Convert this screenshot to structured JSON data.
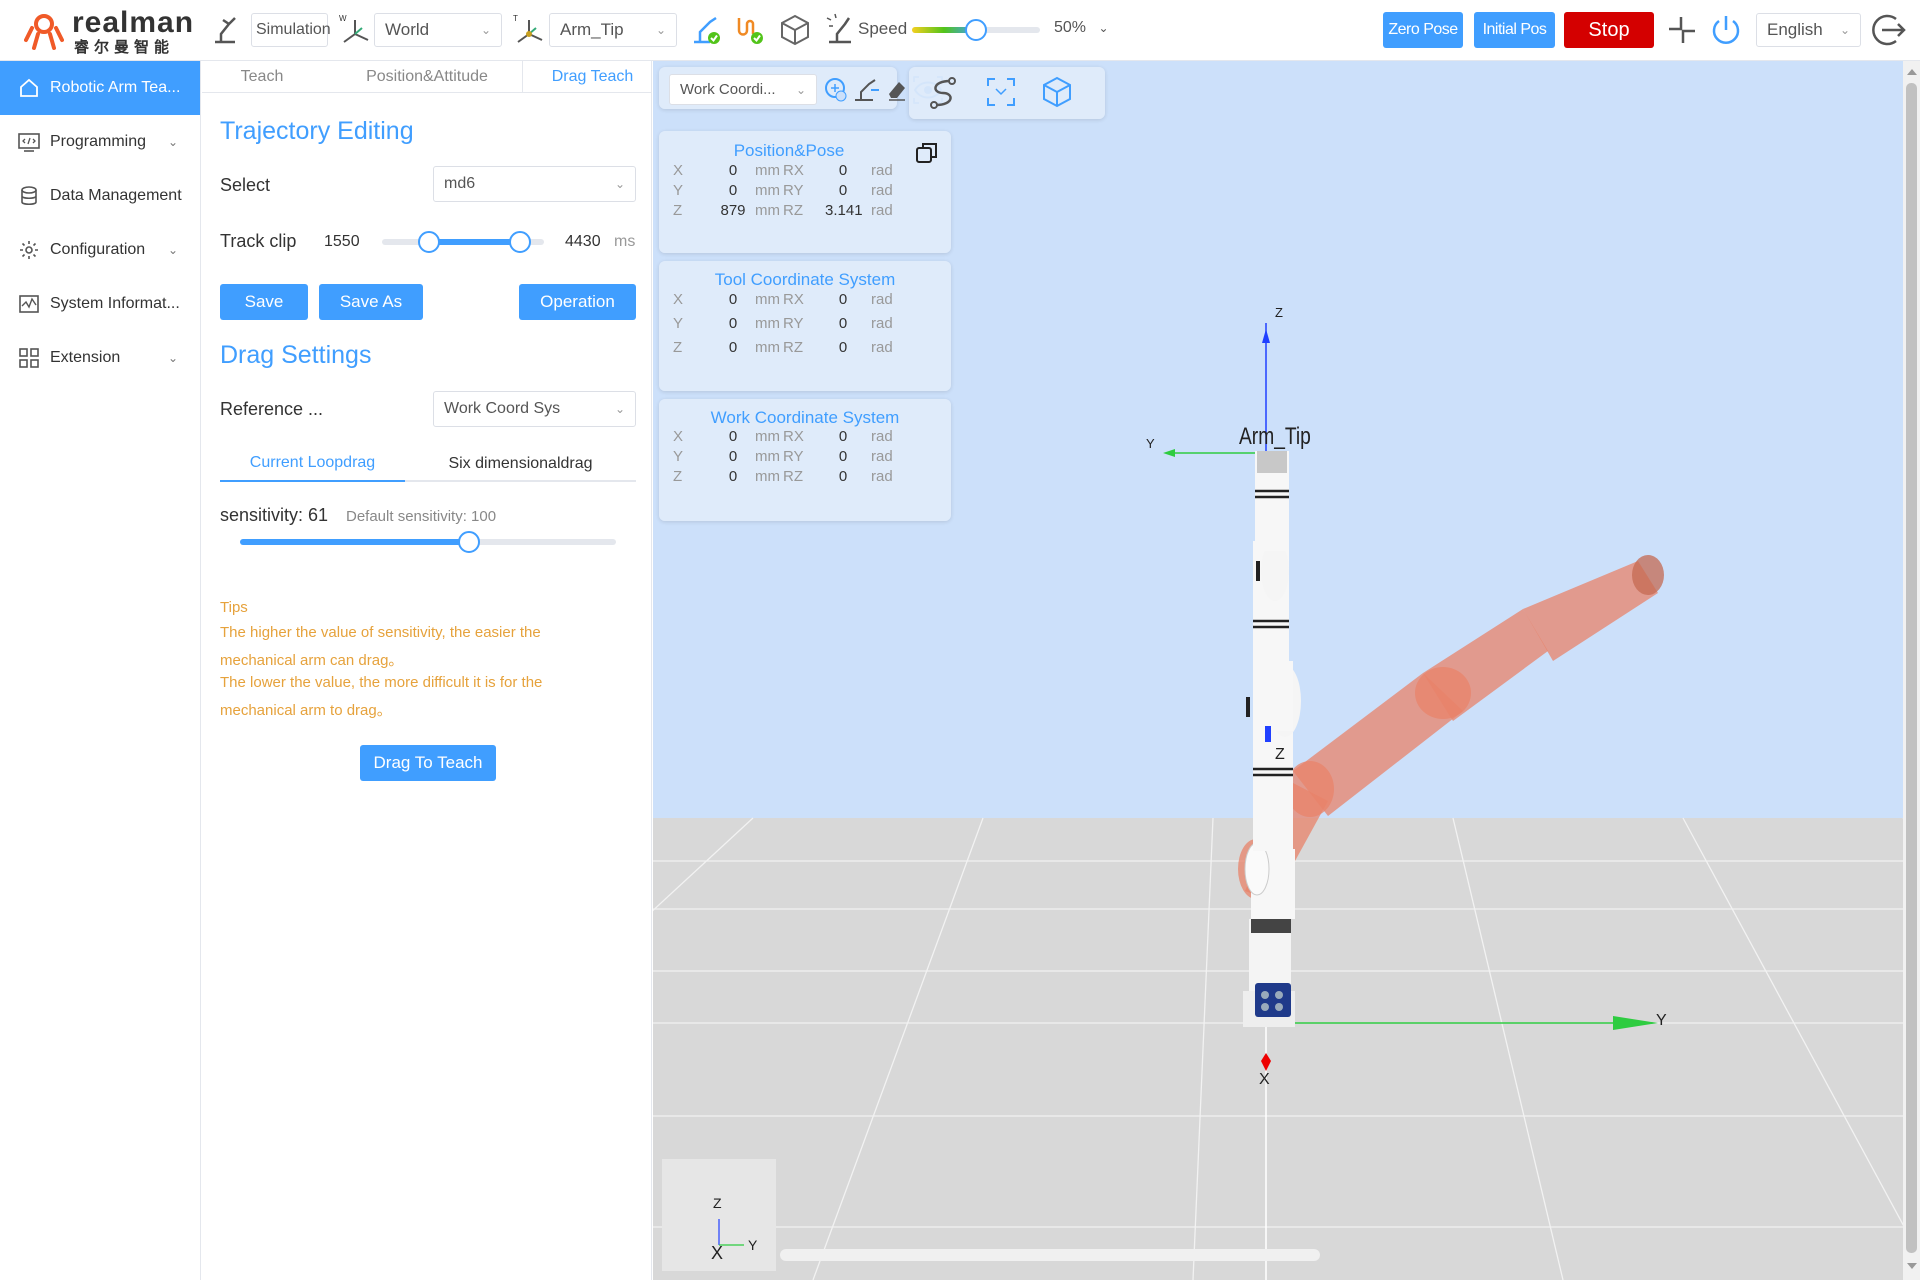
{
  "brand": {
    "name": "realman",
    "subtitle": "睿尔曼智能",
    "color": "#f05a28"
  },
  "topbar": {
    "mode": "Simulation",
    "frame_select": "World",
    "tool_select": "Arm_Tip",
    "speed_label": "Speed",
    "speed_value": "50%",
    "speed_fraction": 0.5,
    "zero_pose": "Zero Pose",
    "initial_pos": "Initial Pos",
    "stop": "Stop",
    "language": "English"
  },
  "sidebar": {
    "items": [
      {
        "label": "Robotic Arm Tea...",
        "icon": "home-icon"
      },
      {
        "label": "Programming",
        "icon": "code-icon"
      },
      {
        "label": "Data Management",
        "icon": "database-icon"
      },
      {
        "label": "Configuration",
        "icon": "gear-icon"
      },
      {
        "label": "System Informat...",
        "icon": "monitor-icon"
      },
      {
        "label": "Extension",
        "icon": "grid-icon"
      }
    ]
  },
  "panel": {
    "tabs": [
      "Teach",
      "Position&Attitude",
      "Drag Teach"
    ],
    "trajectory_title": "Trajectory Editing",
    "select_label": "Select",
    "select_value": "md6",
    "track_clip_label": "Track clip",
    "track_start": "1550",
    "track_end": "4430",
    "track_unit": "ms",
    "save": "Save",
    "save_as": "Save As",
    "operation": "Operation",
    "drag_title": "Drag Settings",
    "reference_label": "Reference ...",
    "reference_value": "Work Coord Sys",
    "subtabs": [
      "Current Loopdrag",
      "Six dimensionaldrag"
    ],
    "sensitivity_label": "sensitivity: 61",
    "default_sensitivity": "Default sensitivity: 100",
    "sensitivity_fraction": 0.61,
    "tips_title": "Tips",
    "tips": [
      "The higher the value of sensitivity, the easier the",
      "mechanical arm can drag。",
      "The lower the value, the more difficult it is for the",
      "mechanical arm to drag。"
    ],
    "drag_to_teach": "Drag To Teach"
  },
  "viewport": {
    "coord_select": "Work Coordi...",
    "cards": [
      {
        "title": "Position&Pose",
        "rows": [
          {
            "axis": "X",
            "val": "0",
            "unit": "mm",
            "raxis": "RX",
            "rval": "0",
            "runit": "rad"
          },
          {
            "axis": "Y",
            "val": "0",
            "unit": "mm",
            "raxis": "RY",
            "rval": "0",
            "runit": "rad"
          },
          {
            "axis": "Z",
            "val": "879",
            "unit": "mm",
            "raxis": "RZ",
            "rval": "3.141",
            "runit": "rad"
          }
        ]
      },
      {
        "title": "Tool Coordinate System",
        "rows": [
          {
            "axis": "X",
            "val": "0",
            "unit": "mm",
            "raxis": "RX",
            "rval": "0",
            "runit": "rad"
          },
          {
            "axis": "Y",
            "val": "0",
            "unit": "mm",
            "raxis": "RY",
            "rval": "0",
            "runit": "rad"
          },
          {
            "axis": "Z",
            "val": "0",
            "unit": "mm",
            "raxis": "RZ",
            "rval": "0",
            "runit": "rad"
          }
        ]
      },
      {
        "title": "Work Coordinate System",
        "rows": [
          {
            "axis": "X",
            "val": "0",
            "unit": "mm",
            "raxis": "RX",
            "rval": "0",
            "runit": "rad"
          },
          {
            "axis": "Y",
            "val": "0",
            "unit": "mm",
            "raxis": "RY",
            "rval": "0",
            "runit": "rad"
          },
          {
            "axis": "Z",
            "val": "0",
            "unit": "mm",
            "raxis": "RZ",
            "rval": "0",
            "runit": "rad"
          }
        ]
      }
    ],
    "tip_label": "Arm_Tip",
    "axes": {
      "z": "Z",
      "y": "Y",
      "x": "X"
    }
  }
}
